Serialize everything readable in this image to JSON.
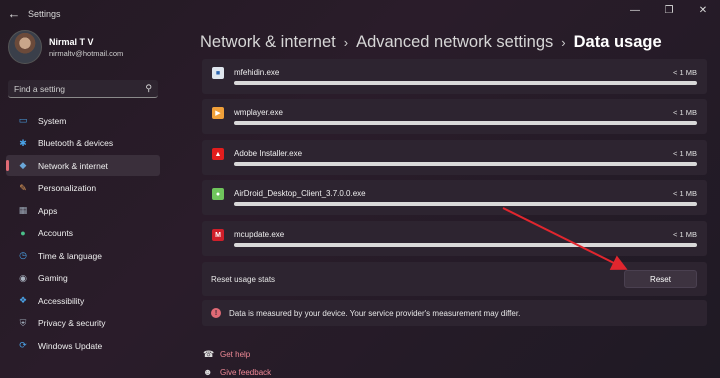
{
  "window": {
    "title": "Settings",
    "back_icon": "back-arrow-icon",
    "controls": [
      "minimize-icon",
      "maximize-icon",
      "close-icon"
    ]
  },
  "profile": {
    "name": "Nirmal T V",
    "email": "nirmaltv@hotmail.com"
  },
  "search": {
    "placeholder": "Find a setting",
    "icon": "search-icon"
  },
  "sidebar": {
    "items": [
      {
        "label": "System",
        "icon": "system-icon",
        "color": "#4aa3e8",
        "active": false
      },
      {
        "label": "Bluetooth & devices",
        "icon": "bluetooth-icon",
        "color": "#4aa3e8",
        "active": false
      },
      {
        "label": "Network & internet",
        "icon": "wifi-icon",
        "color": "#6aa6d8",
        "active": true
      },
      {
        "label": "Personalization",
        "icon": "brush-icon",
        "color": "#e8a05a",
        "active": false
      },
      {
        "label": "Apps",
        "icon": "apps-icon",
        "color": "#9aa6b4",
        "active": false
      },
      {
        "label": "Accounts",
        "icon": "person-icon",
        "color": "#4ac08a",
        "active": false
      },
      {
        "label": "Time & language",
        "icon": "globe-clock-icon",
        "color": "#4aa3e8",
        "active": false
      },
      {
        "label": "Gaming",
        "icon": "gamepad-icon",
        "color": "#aab4c0",
        "active": false
      },
      {
        "label": "Accessibility",
        "icon": "accessibility-icon",
        "color": "#4aa3e8",
        "active": false
      },
      {
        "label": "Privacy & security",
        "icon": "shield-icon",
        "color": "#9aa6b4",
        "active": false
      },
      {
        "label": "Windows Update",
        "icon": "update-icon",
        "color": "#4aa3e8",
        "active": false
      }
    ]
  },
  "breadcrumb": {
    "items": [
      "Network & internet",
      "Advanced network settings",
      "Data usage"
    ]
  },
  "apps": [
    {
      "name": "mfehidin.exe",
      "usage": "< 1 MB",
      "icon": "exe-window-icon",
      "icon_bg": "#dfe6ee",
      "icon_fg": "#2a64b0"
    },
    {
      "name": "wmplayer.exe",
      "usage": "< 1 MB",
      "icon": "media-player-icon",
      "icon_bg": "#f0a03a",
      "icon_fg": "#ffffff"
    },
    {
      "name": "Adobe Installer.exe",
      "usage": "< 1 MB",
      "icon": "adobe-icon",
      "icon_bg": "#e21d1d",
      "icon_fg": "#ffffff"
    },
    {
      "name": "AirDroid_Desktop_Client_3.7.0.0.exe",
      "usage": "< 1 MB",
      "icon": "airdroid-icon",
      "icon_bg": "#6fc55c",
      "icon_fg": "#ffffff"
    },
    {
      "name": "mcupdate.exe",
      "usage": "< 1 MB",
      "icon": "mcafee-icon",
      "icon_bg": "#d01f2a",
      "icon_fg": "#ffffff"
    }
  ],
  "reset": {
    "label": "Reset usage stats",
    "button": "Reset"
  },
  "info": {
    "text": "Data is measured by your device. Your service provider's measurement may differ.",
    "icon": "info-icon"
  },
  "links": [
    {
      "label": "Get help",
      "icon": "help-icon"
    },
    {
      "label": "Give feedback",
      "icon": "feedback-icon"
    }
  ],
  "annotation": {
    "arrow_color": "#e0262e"
  }
}
